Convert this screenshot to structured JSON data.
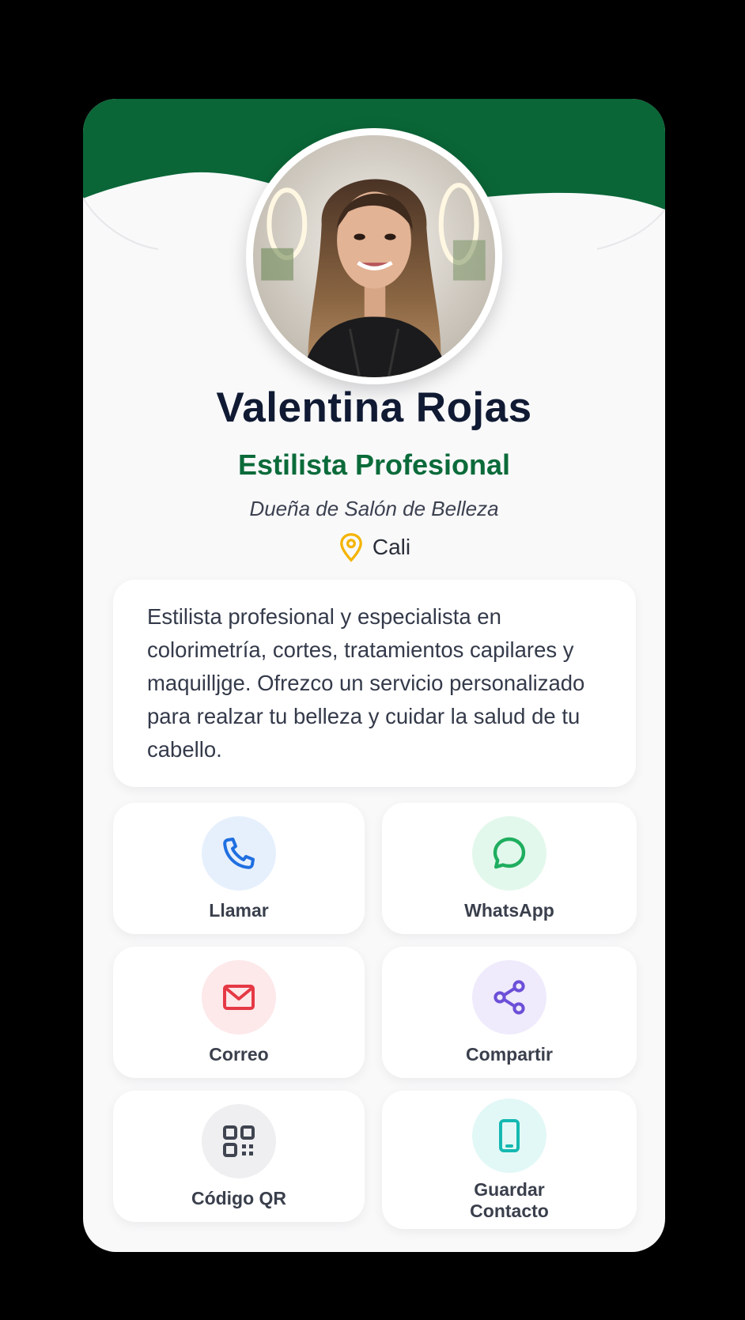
{
  "profile": {
    "name": "Valentina Rojas",
    "title": "Estilista Profesional",
    "subtitle": "Dueña de Salón de Belleza",
    "location": "Cali",
    "bio": "Estilista profesional y especialista en colorimetría, cortes, tratamientos capilares y maquilljge. Ofrezco un servicio personalizado para realzar tu belleza y cuidar la salud de tu cabello."
  },
  "actions": [
    {
      "label": "Llamar",
      "icon": "phone-icon",
      "color": "#1f6fe0",
      "bg": "#e6f0fd"
    },
    {
      "label": "WhatsApp",
      "icon": "whatsapp-icon",
      "color": "#1fae5f",
      "bg": "#e3f8ec"
    },
    {
      "label": "Correo",
      "icon": "mail-icon",
      "color": "#e53945",
      "bg": "#fde8ea"
    },
    {
      "label": "Compartir",
      "icon": "share-icon",
      "color": "#6c4fd8",
      "bg": "#efebfc"
    },
    {
      "label": "Código QR",
      "icon": "qr-code-icon",
      "color": "#3f4450",
      "bg": "#efeff1"
    },
    {
      "label": "Guardar Contacto",
      "icon": "phone-device-icon",
      "color": "#14b8b0",
      "bg": "#e2f8f6"
    }
  ],
  "colors": {
    "brand_green": "#0b6b3a",
    "name_text": "#101a33",
    "location_pin": "#f4b400"
  }
}
